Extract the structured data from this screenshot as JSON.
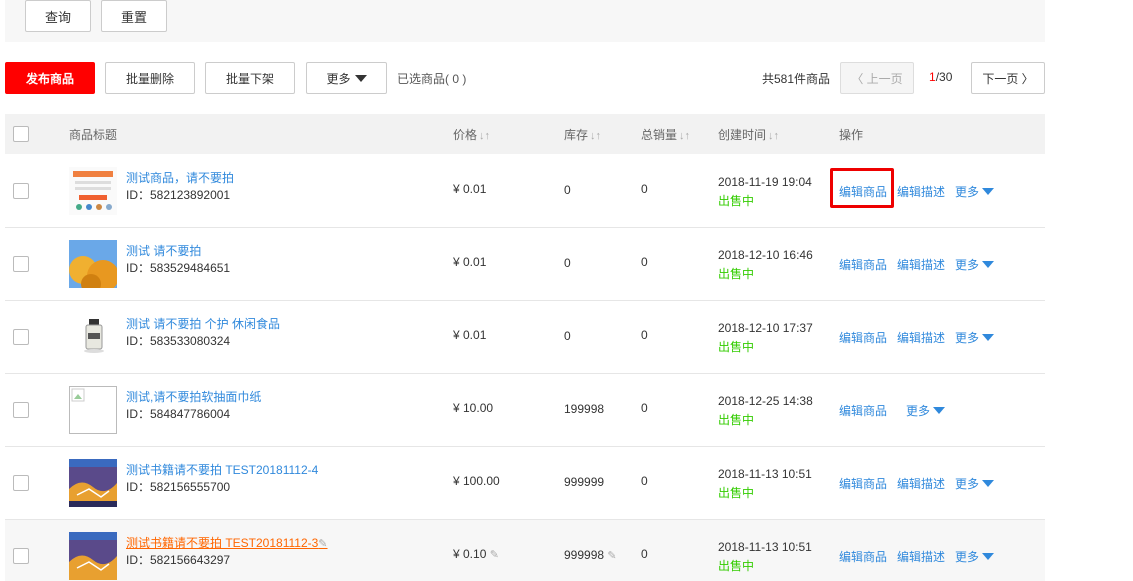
{
  "filter": {
    "query_label": "查询",
    "reset_label": "重置"
  },
  "toolbar": {
    "publish_label": "发布商品",
    "bulk_delete_label": "批量删除",
    "bulk_offshelf_label": "批量下架",
    "more_label": "更多",
    "selected_text": "已选商品( 0 )",
    "total_text": "共581件商品",
    "prev_label": "〈 上一页",
    "page_current": "1",
    "page_total": "/30",
    "next_label": "下一页 〉"
  },
  "table": {
    "headers": {
      "title": "商品标题",
      "price": "价格",
      "stock": "库存",
      "sales": "总销量",
      "created": "创建时间",
      "ops": "操作"
    },
    "sort_symbol": "↓↑",
    "op_edit": "编辑商品",
    "op_desc": "编辑描述",
    "op_more": "更多",
    "rows": [
      {
        "title": "测试商品，请不要拍",
        "id": "ID：582123892001",
        "price": "¥ 0.01",
        "stock": "0",
        "sales": "0",
        "created": "2018-11-19 19:04",
        "status": "出售中"
      },
      {
        "title": "测试 请不要拍",
        "id": "ID：583529484651",
        "price": "¥ 0.01",
        "stock": "0",
        "sales": "0",
        "created": "2018-12-10 16:46",
        "status": "出售中"
      },
      {
        "title": "测试 请不要拍 个护 休闲食品",
        "id": "ID：583533080324",
        "price": "¥ 0.01",
        "stock": "0",
        "sales": "0",
        "created": "2018-12-10 17:37",
        "status": "出售中"
      },
      {
        "title": "测试,请不要拍软抽面巾纸",
        "id": "ID：584847786004",
        "price": "¥ 10.00",
        "stock": "199998",
        "sales": "0",
        "created": "2018-12-25 14:38",
        "status": "出售中"
      },
      {
        "title": "测试书籍请不要拍 TEST20181112-4",
        "id": "ID：582156555700",
        "price": "¥ 100.00",
        "stock": "999999",
        "sales": "0",
        "created": "2018-11-13 10:51",
        "status": "出售中"
      },
      {
        "title": "测试书籍请不要拍 TEST20181112-3",
        "id": "ID：582156643297",
        "price": "¥ 0.10",
        "stock": "999998",
        "sales": "0",
        "created": "2018-11-13 10:51",
        "status": "出售中"
      }
    ]
  },
  "colors": {
    "accent": "#ff0000",
    "link": "#3089dc",
    "status": "#33cc00",
    "highlight": "#ee0000"
  }
}
